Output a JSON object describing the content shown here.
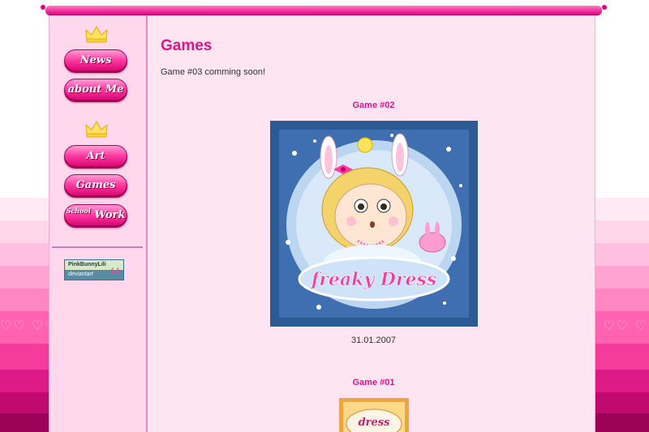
{
  "nav": {
    "news": "News",
    "about_me": "about Me",
    "art": "Art",
    "games": "Games",
    "school_work_small": "School",
    "school_work_big": "Work"
  },
  "badge": {
    "line1": "PinkBunnyLili",
    "line2": "deviantart"
  },
  "main": {
    "title": "Games",
    "intro": "Game #03 comming soon!",
    "games": [
      {
        "heading": "Game #02",
        "thumb_text": "freaky Dress",
        "date": "31.01.2007"
      },
      {
        "heading": "Game #01",
        "thumb_text": "dress"
      }
    ]
  },
  "colors": {
    "accent": "#e0158a",
    "sidebar_bg": "#ffd8ee",
    "content_bg": "#ffe4f2",
    "thumb_border": "#2b5b92"
  },
  "icons": [
    "crown-icon",
    "bunny-icon",
    "heart-icon"
  ]
}
